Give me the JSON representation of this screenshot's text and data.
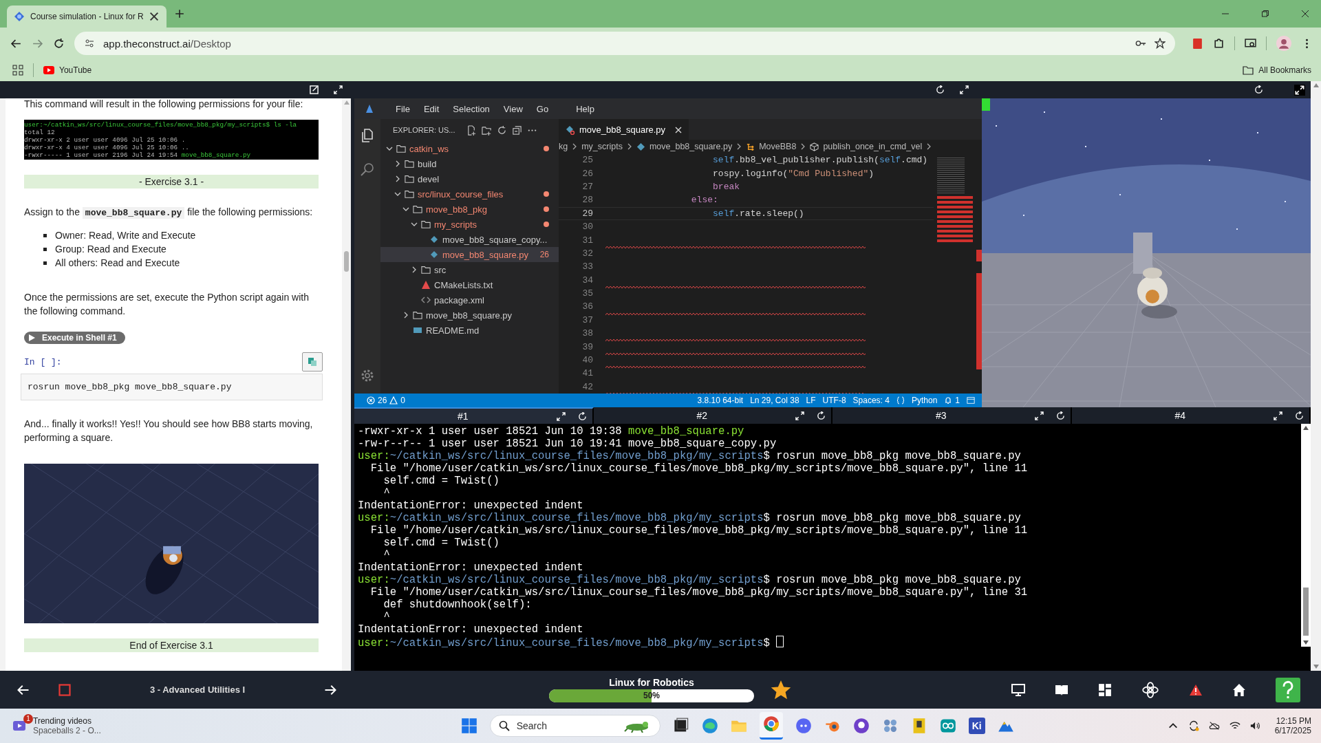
{
  "browser": {
    "tab_title": "Course simulation - Linux for R",
    "url_host": "app.theconstruct.ai",
    "url_path": "/Desktop",
    "bookmarks": [
      {
        "label": "YouTube"
      }
    ],
    "all_bookmarks": "All Bookmarks"
  },
  "notebook": {
    "intro": "This command will result in the following permissions for your file:",
    "terminal_image": [
      {
        "kind": "prompt",
        "text": "user:~/catkin_ws/src/linux_course_files/move_bb8_pkg/my_scripts$ ls -la"
      },
      {
        "kind": "output",
        "text": "total 12"
      },
      {
        "kind": "output",
        "text": "drwxr-xr-x 2 user user 4096 Jul 25 10:06 ."
      },
      {
        "kind": "output",
        "text": "drwxr-xr-x 4 user user 4096 Jul 25 10:06 .."
      },
      {
        "kind": "listing",
        "text": "-rwxr----- 1 user user 2196 Jul 24 19:54 ",
        "file": "move_bb8_square.py"
      }
    ],
    "exercise_title": "- Exercise 3.1 -",
    "assign": {
      "before": "Assign to the ",
      "code": "move_bb8_square.py",
      "after": " file the following permissions:"
    },
    "bullets": [
      "Owner: Read, Write and Execute",
      "Group: Read and Execute",
      "All others: Read and Execute"
    ],
    "paragraph": "Once the permissions are set, execute the Python script again with the following command.",
    "run_button": "Execute in Shell #1",
    "cell_prompt": "In [ ]:",
    "cell_code": "rosrun move_bb8_pkg move_bb8_square.py",
    "result": "And... finally it works!! Yes!! You should see how BB8 starts moving, performing a square.",
    "image": {
      "kind": "picture"
    },
    "end_title": "End of Exercise 3.1"
  },
  "vscode": {
    "menu": [
      "File",
      "Edit",
      "Selection",
      "View",
      "Go",
      "Help"
    ],
    "explorer_title": "EXPLORER: US...",
    "tree": [
      {
        "label": "catkin_ws",
        "kind": "folder",
        "expanded": true,
        "error": true,
        "selected": false,
        "children": [
          {
            "label": "build",
            "kind": "folder",
            "expanded": false,
            "error": false,
            "selected": false
          },
          {
            "label": "devel",
            "kind": "folder",
            "expanded": false,
            "error": false,
            "selected": false
          },
          {
            "label": "src/linux_course_files",
            "kind": "folder",
            "expanded": true,
            "error": true,
            "selected": false,
            "children": [
              {
                "label": "move_bb8_pkg",
                "kind": "folder",
                "expanded": true,
                "error": true,
                "selected": false,
                "children": [
                  {
                    "label": "my_scripts",
                    "kind": "folder",
                    "expanded": true,
                    "error": true,
                    "selected": false,
                    "children": [
                      {
                        "label": "move_bb8_square_copy...",
                        "kind": "python",
                        "error": false,
                        "selected": false
                      },
                      {
                        "label": "move_bb8_square.py",
                        "kind": "python",
                        "error": true,
                        "selected": true,
                        "badge": "26"
                      }
                    ]
                  },
                  {
                    "label": "src",
                    "kind": "folder",
                    "expanded": false,
                    "error": false,
                    "selected": false
                  },
                  {
                    "label": "CMakeLists.txt",
                    "kind": "cmake",
                    "error": false,
                    "selected": false
                  },
                  {
                    "label": "package.xml",
                    "kind": "xml",
                    "error": false,
                    "selected": false
                  }
                ]
              },
              {
                "label": "move_bb8_square.py",
                "kind": "folder",
                "expanded": false,
                "error": false,
                "selected": false
              },
              {
                "label": "README.md",
                "kind": "markdown",
                "error": false,
                "selected": false
              }
            ]
          }
        ]
      }
    ],
    "editor_tab": {
      "label": "move_bb8_square.py",
      "error": true
    },
    "breadcrumbs": [
      {
        "label": "kg",
        "kind": "folder"
      },
      {
        "label": "my_scripts",
        "kind": "folder"
      },
      {
        "label": "move_bb8_square.py",
        "kind": "python"
      },
      {
        "label": "MoveBB8",
        "kind": "class"
      },
      {
        "label": "publish_once_in_cmd_vel",
        "kind": "method"
      }
    ],
    "lines": [
      {
        "number": "25",
        "current": false,
        "squiggle": false,
        "tokens": [
          {
            "t": "                    self",
            "kind": "self"
          },
          {
            "t": ".bb8_vel_publisher.publish(",
            "kind": "plain"
          },
          {
            "t": "self",
            "kind": "self"
          },
          {
            "t": ".cmd)",
            "kind": "plain"
          }
        ]
      },
      {
        "number": "26",
        "current": false,
        "squiggle": false,
        "tokens": [
          {
            "t": "                    rospy.loginfo(",
            "kind": "plain"
          },
          {
            "t": "\"Cmd Published\"",
            "kind": "string"
          },
          {
            "t": ")",
            "kind": "plain"
          }
        ]
      },
      {
        "number": "27",
        "current": false,
        "squiggle": false,
        "tokens": [
          {
            "t": "                    break",
            "kind": "keyword"
          }
        ]
      },
      {
        "number": "28",
        "current": false,
        "squiggle": false,
        "tokens": [
          {
            "t": "                else:",
            "kind": "keyword"
          }
        ]
      },
      {
        "number": "29",
        "current": true,
        "squiggle": false,
        "tokens": [
          {
            "t": "                    self",
            "kind": "self"
          },
          {
            "t": ".rate.sleep()",
            "kind": "plain"
          }
        ]
      },
      {
        "number": "30",
        "current": false,
        "squiggle": false
      },
      {
        "number": "31",
        "current": false,
        "squiggle": true
      },
      {
        "number": "32",
        "current": false,
        "squiggle": false
      },
      {
        "number": "33",
        "current": false,
        "squiggle": false
      },
      {
        "number": "34",
        "current": false,
        "squiggle": true
      },
      {
        "number": "35",
        "current": false,
        "squiggle": false
      },
      {
        "number": "36",
        "current": false,
        "squiggle": true
      },
      {
        "number": "37",
        "current": false,
        "squiggle": false
      },
      {
        "number": "38",
        "current": false,
        "squiggle": true
      },
      {
        "number": "39",
        "current": false,
        "squiggle": true
      },
      {
        "number": "40",
        "current": false,
        "squiggle": true
      },
      {
        "number": "41",
        "current": false,
        "squiggle": false
      },
      {
        "number": "42",
        "current": false,
        "squiggle": true
      }
    ],
    "status": {
      "errors": "26",
      "warnings": "0",
      "items": [
        "3.8.10 64-bit",
        "Ln 29, Col 38",
        "LF",
        "UTF-8",
        "Spaces: 4",
        "Python"
      ],
      "notifications": "1"
    }
  },
  "terminal": {
    "tabs": [
      {
        "label": "#1",
        "selected": true
      },
      {
        "label": "#2",
        "selected": false
      },
      {
        "label": "#3",
        "selected": false
      },
      {
        "label": "#4",
        "selected": false
      }
    ],
    "lines": [
      {
        "kind": "listing",
        "text": "-rwxr-xr-x 1 user user 18521 Jun 10 19:38 ",
        "file": "move_bb8_square.py"
      },
      {
        "kind": "output",
        "text": "-rw-r--r-- 1 user user 18521 Jun 10 19:41 move_bb8_square_copy.py"
      },
      {
        "kind": "prompt",
        "user": "user:",
        "path": "~/catkin_ws/src/linux_course_files/move_bb8_pkg/my_scripts",
        "command": "$ rosrun move_bb8_pkg move_bb8_square.py"
      },
      {
        "kind": "output",
        "text": "  File \"/home/user/catkin_ws/src/linux_course_files/move_bb8_pkg/my_scripts/move_bb8_square.py\", line 11"
      },
      {
        "kind": "output",
        "text": "    self.cmd = Twist()"
      },
      {
        "kind": "output",
        "text": "    ^"
      },
      {
        "kind": "output",
        "text": "IndentationError: unexpected indent"
      },
      {
        "kind": "prompt",
        "user": "user:",
        "path": "~/catkin_ws/src/linux_course_files/move_bb8_pkg/my_scripts",
        "command": "$ rosrun move_bb8_pkg move_bb8_square.py"
      },
      {
        "kind": "output",
        "text": "  File \"/home/user/catkin_ws/src/linux_course_files/move_bb8_pkg/my_scripts/move_bb8_square.py\", line 11"
      },
      {
        "kind": "output",
        "text": "    self.cmd = Twist()"
      },
      {
        "kind": "output",
        "text": "    ^"
      },
      {
        "kind": "output",
        "text": "IndentationError: unexpected indent"
      },
      {
        "kind": "prompt",
        "user": "user:",
        "path": "~/catkin_ws/src/linux_course_files/move_bb8_pkg/my_scripts",
        "command": "$ rosrun move_bb8_pkg move_bb8_square.py"
      },
      {
        "kind": "output",
        "text": "  File \"/home/user/catkin_ws/src/linux_course_files/move_bb8_pkg/my_scripts/move_bb8_square.py\", line 31"
      },
      {
        "kind": "output",
        "text": "    def shutdownhook(self):"
      },
      {
        "kind": "output",
        "text": "    ^"
      },
      {
        "kind": "output",
        "text": "IndentationError: unexpected indent"
      },
      {
        "kind": "prompt",
        "user": "user:",
        "path": "~/catkin_ws/src/linux_course_files/move_bb8_pkg/my_scripts",
        "command": "$ ",
        "cursor": true
      }
    ]
  },
  "course_bar": {
    "lesson": "3 - Advanced Utilities I",
    "course": "Linux for Robotics",
    "level": 0.5,
    "reading": "50%"
  },
  "taskbar": {
    "news_badge": "1",
    "news_title": "Trending videos",
    "news_subtitle": "Spaceballs 2 - O...",
    "search_placeholder": "Search",
    "kicad_label": "Ki",
    "time": "12:15 PM",
    "date": "6/17/2025"
  }
}
